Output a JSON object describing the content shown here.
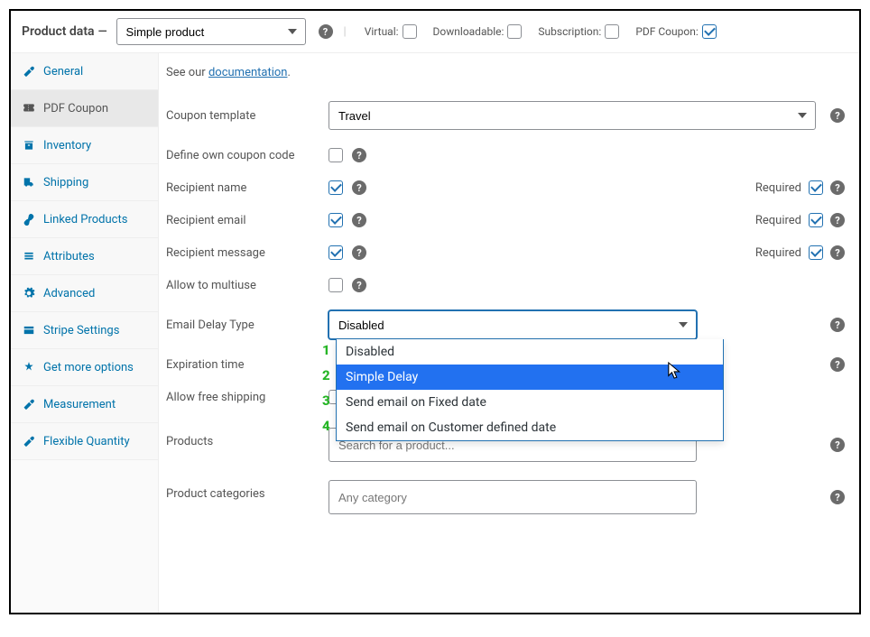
{
  "header": {
    "title": "Product data",
    "dash": "—",
    "product_type": "Simple product",
    "options": {
      "virtual": {
        "label": "Virtual:",
        "checked": false
      },
      "downloadable": {
        "label": "Downloadable:",
        "checked": false
      },
      "subscription": {
        "label": "Subscription:",
        "checked": false
      },
      "pdf_coupon": {
        "label": "PDF Coupon:",
        "checked": true
      }
    }
  },
  "tabs": {
    "general": "General",
    "pdf_coupon": "PDF Coupon",
    "inventory": "Inventory",
    "shipping": "Shipping",
    "linked_products": "Linked Products",
    "attributes": "Attributes",
    "advanced": "Advanced",
    "stripe": "Stripe Settings",
    "get_more": "Get more options",
    "measurement": "Measurement",
    "flexible_qty": "Flexible Quantity"
  },
  "content": {
    "intro_prefix": "See our ",
    "intro_link": "documentation",
    "intro_suffix": ".",
    "rows": {
      "coupon_template": {
        "label": "Coupon template",
        "value": "Travel"
      },
      "define_own": {
        "label": "Define own coupon code",
        "checked": false
      },
      "recipient_name": {
        "label": "Recipient name",
        "checked": true,
        "required_label": "Required",
        "required_checked": true
      },
      "recipient_email": {
        "label": "Recipient email",
        "checked": true,
        "required_label": "Required",
        "required_checked": true
      },
      "recipient_message": {
        "label": "Recipient message",
        "checked": true,
        "required_label": "Required",
        "required_checked": true
      },
      "allow_multiuse": {
        "label": "Allow to multiuse",
        "checked": false
      },
      "email_delay": {
        "label": "Email Delay Type",
        "value": "Disabled",
        "options": [
          "Disabled",
          "Simple Delay",
          "Send email on Fixed date",
          "Send email on Customer defined date"
        ],
        "option_numbers": [
          "1",
          "2",
          "3",
          "4"
        ],
        "highlighted_index": 1
      },
      "expiration": {
        "label": "Expiration time"
      },
      "allow_free_shipping": {
        "label": "Allow free shipping",
        "checked": false
      },
      "products": {
        "label": "Products",
        "placeholder": "Search for a product..."
      },
      "product_categories": {
        "label": "Product categories",
        "placeholder": "Any category"
      }
    }
  }
}
